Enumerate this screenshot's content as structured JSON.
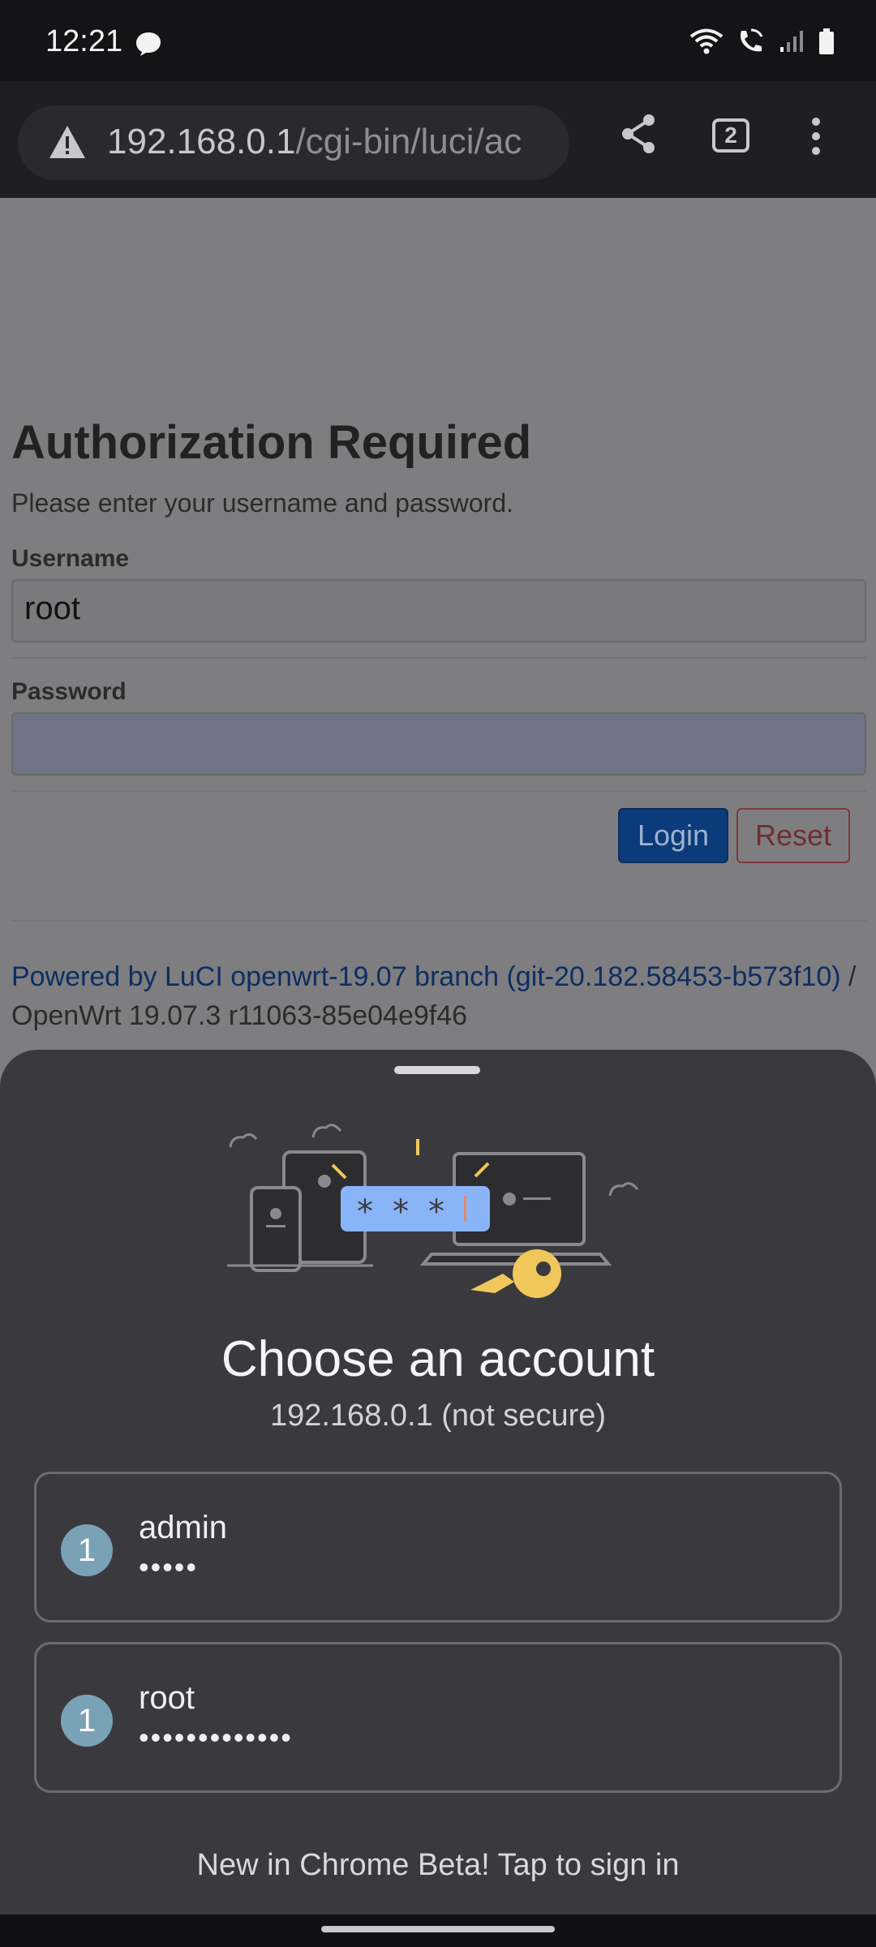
{
  "status_bar": {
    "time": "12:21",
    "icons": [
      "message-icon",
      "wifi-icon",
      "wifi-calling-icon",
      "signal-icon",
      "battery-icon"
    ]
  },
  "browser": {
    "url_host": "192.168.0.1",
    "url_path": "/cgi-bin/luci/ac",
    "warning_icon": "warning-icon",
    "tab_count": "2"
  },
  "page": {
    "title": "Authorization Required",
    "subtitle": "Please enter your username and password.",
    "username_label": "Username",
    "username_value": "root",
    "password_label": "Password",
    "password_value": "",
    "login_label": "Login",
    "reset_label": "Reset",
    "footer_link": "Powered by LuCI openwrt-19.07 branch (git-20.182.58453-b573f10)",
    "footer_rest": " / OpenWrt 19.07.3 r11063-85e04e9f46"
  },
  "sheet": {
    "title": "Choose an account",
    "subtitle": "192.168.0.1 (not secure)",
    "accounts": [
      {
        "badge": "1",
        "username": "admin",
        "password_mask": "•••••"
      },
      {
        "badge": "1",
        "username": "root",
        "password_mask": "•••••••••••••"
      }
    ],
    "signin_text": "New in Chrome Beta! Tap to sign in"
  },
  "colors": {
    "sheet_bg": "#3a3a3e",
    "login_button": "#0b3b7a",
    "avatar": "#7aa2b6",
    "link": "#0d2e63"
  }
}
